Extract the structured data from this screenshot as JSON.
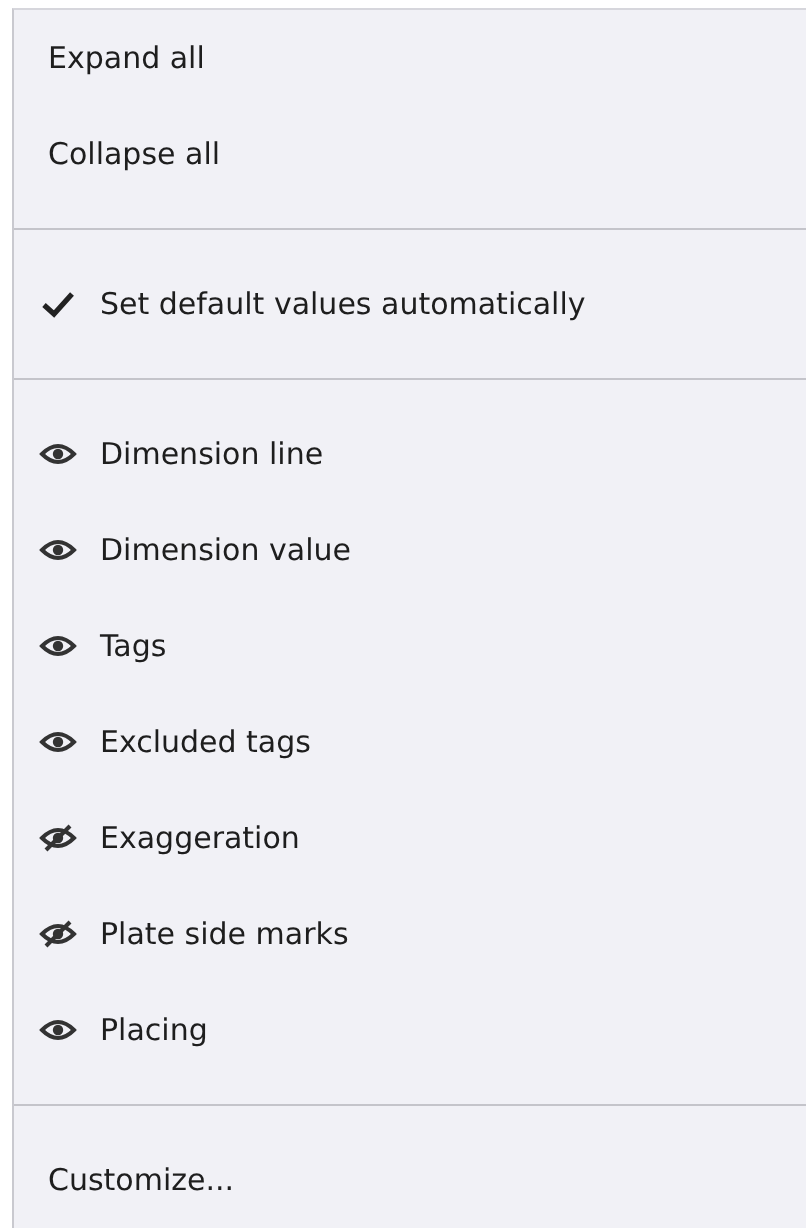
{
  "menu": {
    "sections": [
      {
        "items": [
          {
            "kind": "action",
            "label": "Expand all"
          },
          {
            "kind": "action",
            "label": "Collapse all"
          }
        ]
      },
      {
        "items": [
          {
            "kind": "check",
            "label": "Set default values automatically",
            "checked": true
          }
        ]
      },
      {
        "items": [
          {
            "kind": "visibility",
            "label": "Dimension line",
            "visible": true
          },
          {
            "kind": "visibility",
            "label": "Dimension value",
            "visible": true
          },
          {
            "kind": "visibility",
            "label": "Tags",
            "visible": true
          },
          {
            "kind": "visibility",
            "label": "Excluded tags",
            "visible": true
          },
          {
            "kind": "visibility",
            "label": "Exaggeration",
            "visible": false
          },
          {
            "kind": "visibility",
            "label": "Plate side marks",
            "visible": false
          },
          {
            "kind": "visibility",
            "label": "Placing",
            "visible": true
          }
        ]
      },
      {
        "items": [
          {
            "kind": "action",
            "label": "Customize..."
          }
        ]
      }
    ]
  }
}
